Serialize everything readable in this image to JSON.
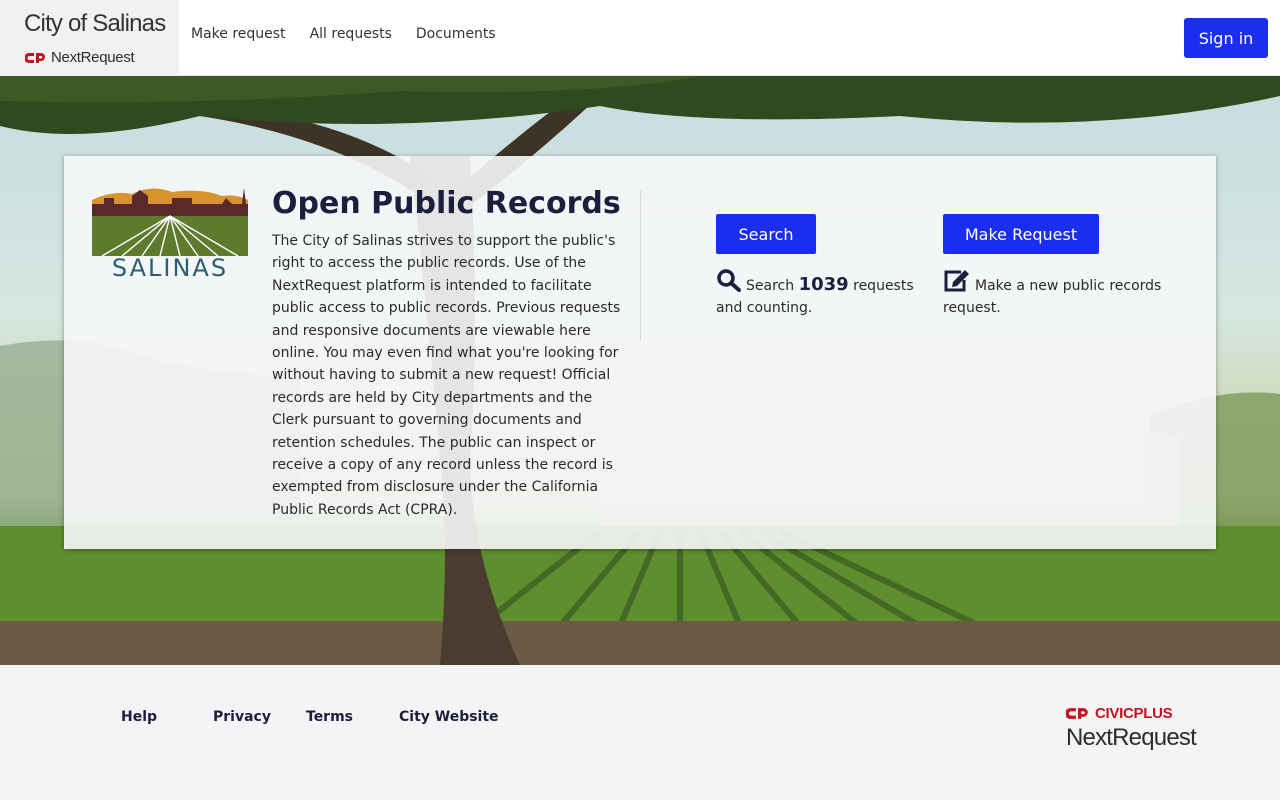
{
  "header": {
    "brand_title": "City of Salinas",
    "brand_sub": "NextRequest",
    "nav": [
      "Make request",
      "All requests",
      "Documents"
    ],
    "sign_in": "Sign in"
  },
  "main": {
    "title": "Open Public Records",
    "logo_text": "SALINAS",
    "description": "The City of Salinas strives to support the public's right to access the public records. Use of the NextRequest platform is intended to facilitate public access to public records. Previous requests and responsive documents are viewable here online. You may even find what you're looking for without having to submit a new request! Official records are held by City departments and the Clerk pursuant to governing documents and retention schedules. The public can inspect or receive a copy of any record unless the record is exempted from disclosure under the California Public Records Act (CPRA).",
    "search_button": "Search",
    "make_request_button": "Make Request",
    "search_prefix": "Search",
    "request_count": "1039",
    "search_suffix": "requests and counting.",
    "make_text": "Make a new public records request."
  },
  "footer": {
    "links": [
      "Help",
      "Privacy",
      "Terms",
      "City Website"
    ],
    "civicplus": "CIVICPLUS",
    "nextrequest": "NextRequest"
  },
  "colors": {
    "accent": "#1b2ef0",
    "brand_red": "#c4121e",
    "heading": "#1d1d3d"
  },
  "icons": [
    "civicplus-logo-icon",
    "search-icon",
    "edit-icon"
  ]
}
